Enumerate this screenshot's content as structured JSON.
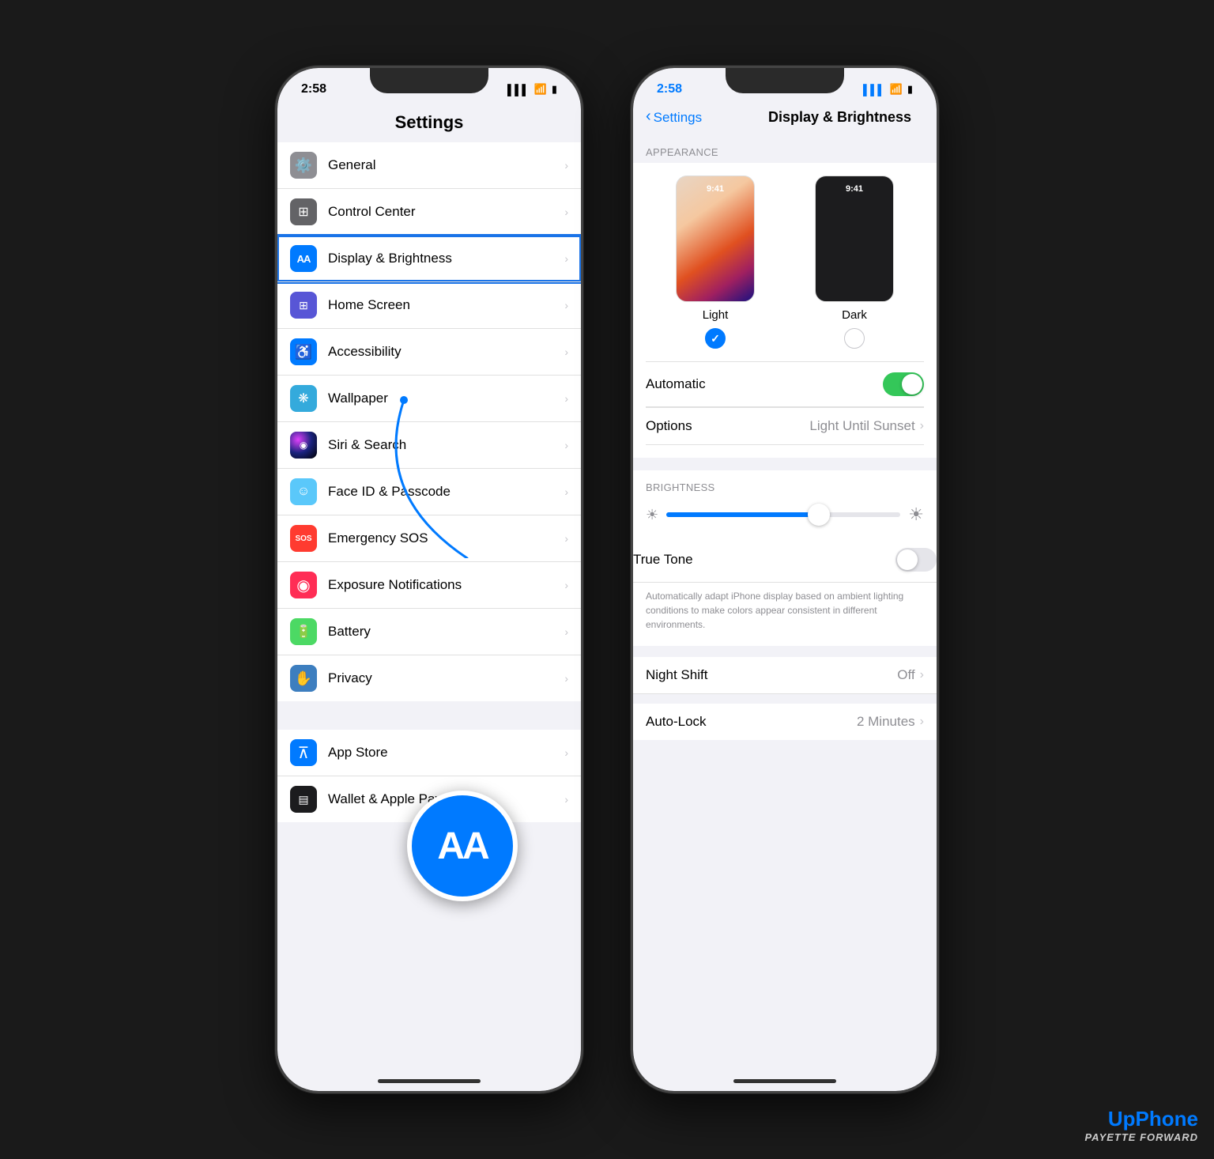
{
  "phone1": {
    "status": {
      "time": "2:58",
      "signal": "▌▌▌",
      "wifi": "WiFi",
      "battery": "🔋"
    },
    "header": "Settings",
    "items": [
      {
        "id": "general",
        "label": "General",
        "icon_color": "#8e8e93",
        "icon_type": "gear"
      },
      {
        "id": "control-center",
        "label": "Control Center",
        "icon_color": "#636366",
        "icon_type": "sliders"
      },
      {
        "id": "display",
        "label": "Display & Brightness",
        "icon_color": "#007aff",
        "icon_type": "aa",
        "active": true
      },
      {
        "id": "home-screen",
        "label": "Home Screen",
        "icon_color": "#5856d6",
        "icon_type": "grid"
      },
      {
        "id": "accessibility",
        "label": "Accessibility",
        "icon_color": "#007aff",
        "icon_type": "person"
      },
      {
        "id": "wallpaper",
        "label": "Wallpaper",
        "icon_color": "#34aadc",
        "icon_type": "flower"
      },
      {
        "id": "siri",
        "label": "Siri & Search",
        "icon_color": "#1c1c1e",
        "icon_type": "siri"
      },
      {
        "id": "faceid",
        "label": "Face ID & Passcode",
        "icon_color": "#5ac8fa",
        "icon_type": "face"
      },
      {
        "id": "sos",
        "label": "Emergency SOS",
        "icon_color": "#ff3b30",
        "icon_type": "sos"
      },
      {
        "id": "exposure",
        "label": "Exposure Notifications",
        "icon_color": "#ff2d55",
        "icon_type": "dot"
      },
      {
        "id": "battery",
        "label": "Battery",
        "icon_color": "#4cd964",
        "icon_type": "battery"
      },
      {
        "id": "privacy",
        "label": "Privacy",
        "icon_color": "#3d7ebf",
        "icon_type": "hand"
      }
    ],
    "items2": [
      {
        "id": "appstore",
        "label": "App Store",
        "icon_color": "#007aff",
        "icon_type": "store"
      },
      {
        "id": "wallet",
        "label": "Wallet & Apple Pay",
        "icon_color": "#1c1c1e",
        "icon_type": "wallet"
      }
    ],
    "aa_circle_label": "AA"
  },
  "phone2": {
    "status": {
      "time": "2:58"
    },
    "nav": {
      "back_label": "Settings",
      "title": "Display & Brightness"
    },
    "appearance": {
      "section_header": "APPEARANCE",
      "light_label": "Light",
      "dark_label": "Dark",
      "light_selected": true,
      "dark_selected": false
    },
    "automatic": {
      "label": "Automatic",
      "enabled": true
    },
    "options": {
      "label": "Options",
      "value": "Light Until Sunset"
    },
    "brightness": {
      "section_header": "BRIGHTNESS",
      "slider_percent": 65
    },
    "true_tone": {
      "label": "True Tone",
      "enabled": false,
      "description": "Automatically adapt iPhone display based on ambient lighting conditions to make colors appear consistent in different environments."
    },
    "night_shift": {
      "label": "Night Shift",
      "value": "Off"
    },
    "auto_lock": {
      "label": "Auto-Lock",
      "value": "2 Minutes"
    }
  },
  "watermark": {
    "line1_pre": "Up",
    "line1_accent": "Phone",
    "line2": "PAYETTE FORWARD"
  }
}
